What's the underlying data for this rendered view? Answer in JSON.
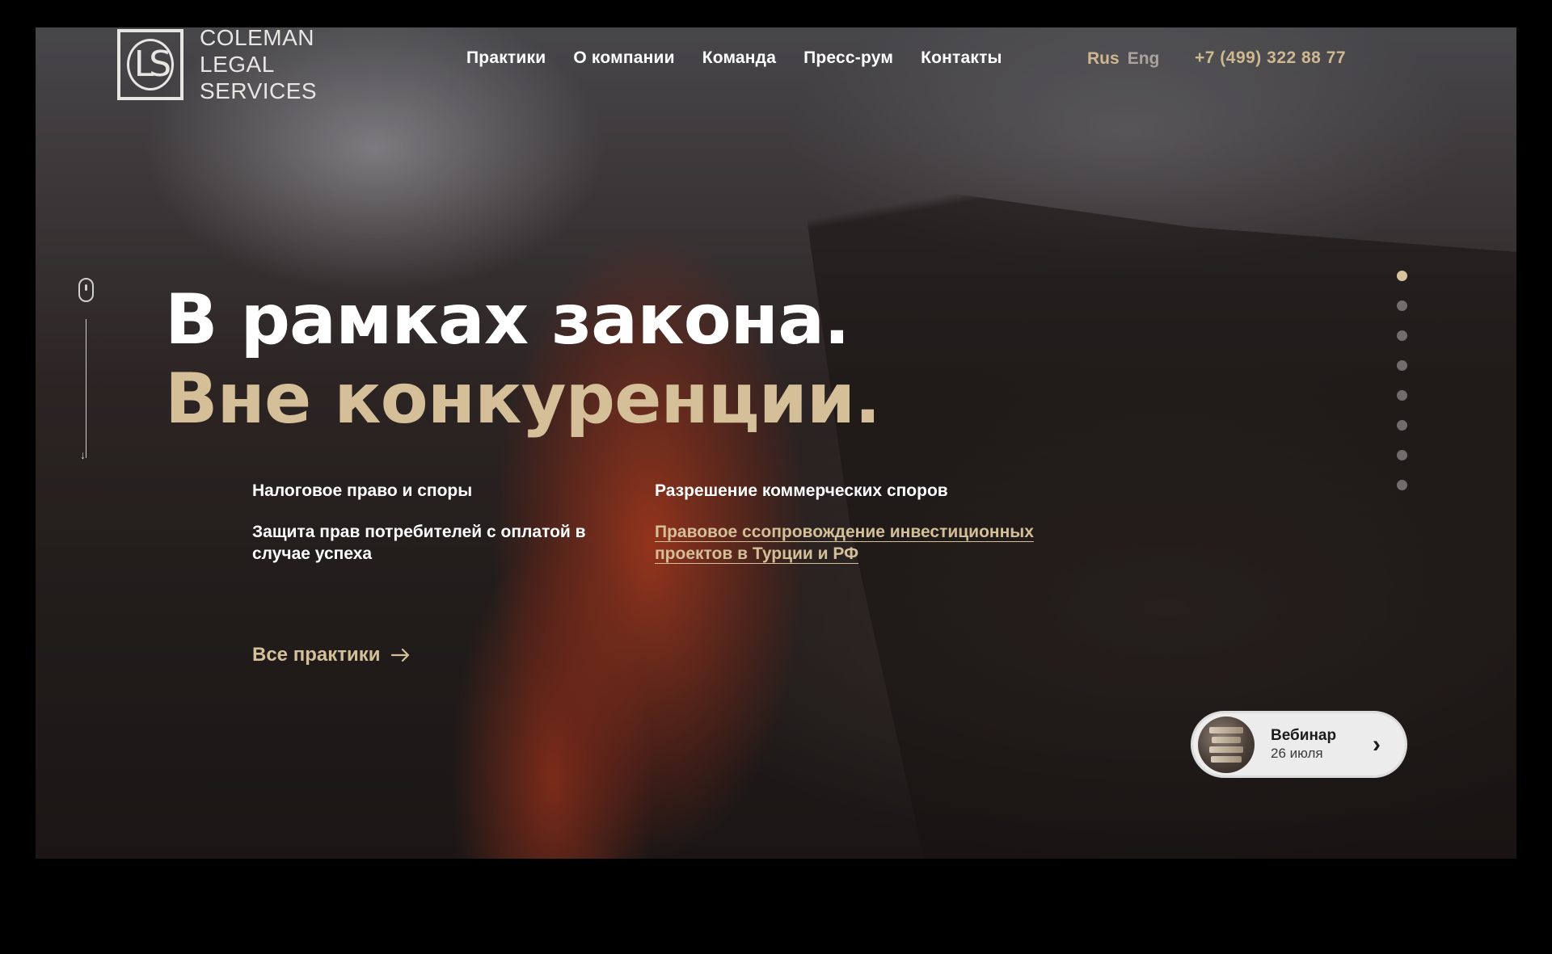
{
  "brand": {
    "logo_letters": "LS",
    "name_line1": "COLEMAN",
    "name_line2": "LEGAL",
    "name_line3": "SERVICES"
  },
  "nav": {
    "items": [
      "Практики",
      "О компании",
      "Команда",
      "Пресс-рум",
      "Контакты"
    ]
  },
  "language": {
    "active": "Rus",
    "inactive": "Eng"
  },
  "phone": "+7 (499) 322 88 77",
  "hero": {
    "headline_line1": "В рамках закона.",
    "headline_line2": "Вне конкуренции."
  },
  "practices": {
    "items": [
      "Налоговое право и споры",
      "Разрешение коммерческих споров",
      "Защита прав потребителей с оплатой в случае успеха",
      "Правовое ссопровождение инвестиционных проектов в Турции и РФ"
    ],
    "all_link": "Все практики"
  },
  "slider": {
    "count": 8,
    "active_index": 0
  },
  "webinar": {
    "title": "Вебинар",
    "date": "26 июля"
  },
  "colors": {
    "accent": "#d4bf98",
    "text": "#ffffff",
    "pill_bg": "#ececec"
  },
  "icons": {
    "scroll": "mouse-icon",
    "arrow": "arrow-right-icon",
    "chevron": "chevron-right-icon"
  }
}
